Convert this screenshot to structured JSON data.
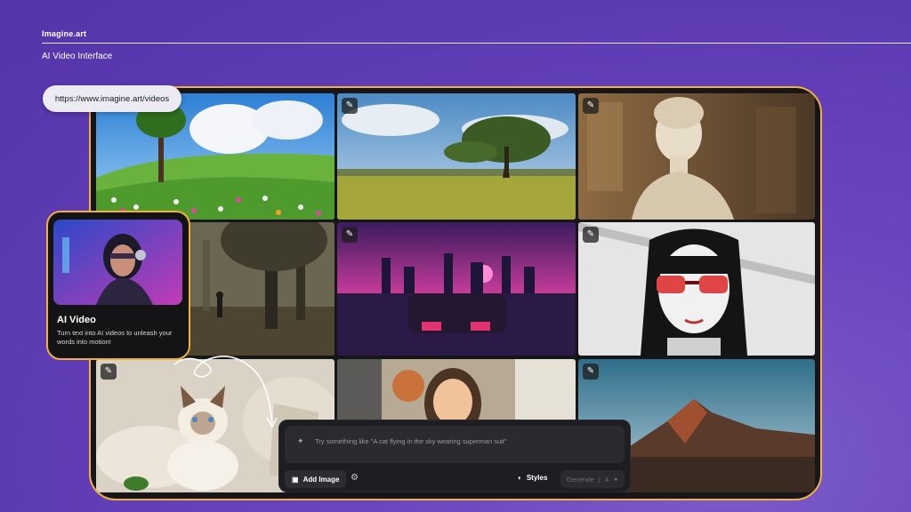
{
  "header": {
    "brand": "Imagine.art",
    "subtitle": "AI Video Interface"
  },
  "url_bar": {
    "url": "https://www.imagine.art/videos"
  },
  "gallery": {
    "badge_icon": "magic-wand-icon",
    "tiles": [
      "meadow-flowers",
      "lone-tree-savanna",
      "marble-statue",
      "foggy-park-walk",
      "synthwave-city-car",
      "anime-girl-red-glasses",
      "ragdoll-cat-blankets",
      "cartoon-girl",
      "mountain-desert"
    ]
  },
  "ai_card": {
    "title": "AI Video",
    "description": "Turn text into AI videos to unleash your words into motion!"
  },
  "prompt": {
    "placeholder": "Try something like \"A cat flying in the sky wearing superman suit\"",
    "add_image_label": "Add Image",
    "styles_label": "Styles",
    "generate_label": "Generate",
    "credits": "4"
  },
  "colors": {
    "accent_border": "#f1b13a",
    "background": "#6a45c0"
  }
}
